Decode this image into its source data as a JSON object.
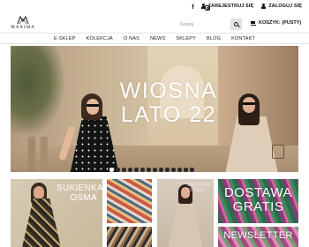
{
  "brand": {
    "name": "MAXIMA",
    "icon": "maxima-logo"
  },
  "social": [
    {
      "icon": "facebook-icon",
      "glyph": "f"
    },
    {
      "icon": "instagram-icon"
    }
  ],
  "account": {
    "register_label": "ZAREJESTRUJ SIĘ",
    "login_label": "ZALOGUJ SIĘ"
  },
  "search": {
    "placeholder": "Szukaj"
  },
  "cart": {
    "label": "KOSZYK: (PUSTY)",
    "icon": "cart-icon"
  },
  "nav": {
    "items": [
      {
        "label": "E-SKLEP"
      },
      {
        "label": "KOLEKCJA"
      },
      {
        "label": "O NAS"
      },
      {
        "label": "NEWS"
      },
      {
        "label": "SKLEPY"
      },
      {
        "label": "BLOG"
      },
      {
        "label": "KONTAKT"
      }
    ]
  },
  "hero": {
    "line1": "WIOSNA",
    "line2": "LATO 22",
    "slides_count": 14,
    "active_slide": 1
  },
  "tiles": {
    "t1_label_line1": "SUKIENKA",
    "t1_label_line2": "OSMA",
    "t4_label": "SUKIENKA COSMA",
    "t5_label_line1": "DOSTAWA",
    "t5_label_line2": "GRATIS",
    "t6_label": "NEWSLETTER"
  }
}
